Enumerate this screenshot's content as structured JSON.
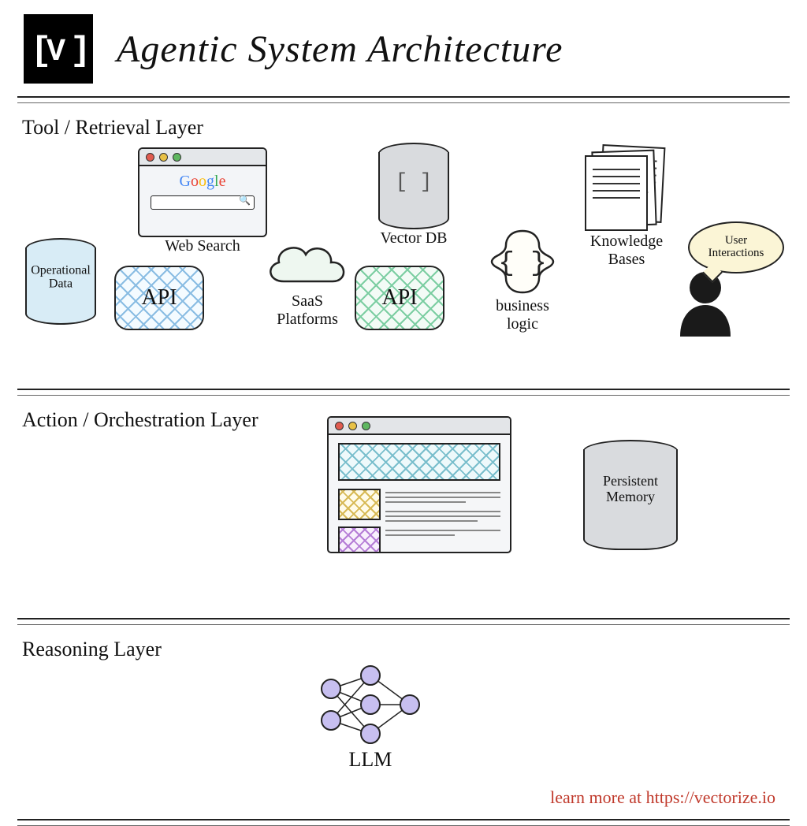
{
  "title": "Agentic System Architecture",
  "logo_letter": "V",
  "layers": {
    "tool": {
      "heading": "Tool / Retrieval Layer",
      "operational_data": "Operational\nData",
      "api_blue": "API",
      "web_search": "Web Search",
      "google": "Google",
      "saas": "SaaS\nPlatforms",
      "api_green": "API",
      "vector_db": "Vector DB",
      "vector_db_glyph": "[ ]",
      "business_logic": "business\nlogic",
      "business_logic_glyph": "{ }",
      "knowledge_bases": "Knowledge\nBases",
      "user_interactions": "User\nInteractions"
    },
    "action": {
      "heading": "Action / Orchestration Layer",
      "persistent_memory": "Persistent\nMemory"
    },
    "reasoning": {
      "heading": "Reasoning Layer",
      "llm": "LLM"
    }
  },
  "footer": "learn more at https://vectorize.io"
}
